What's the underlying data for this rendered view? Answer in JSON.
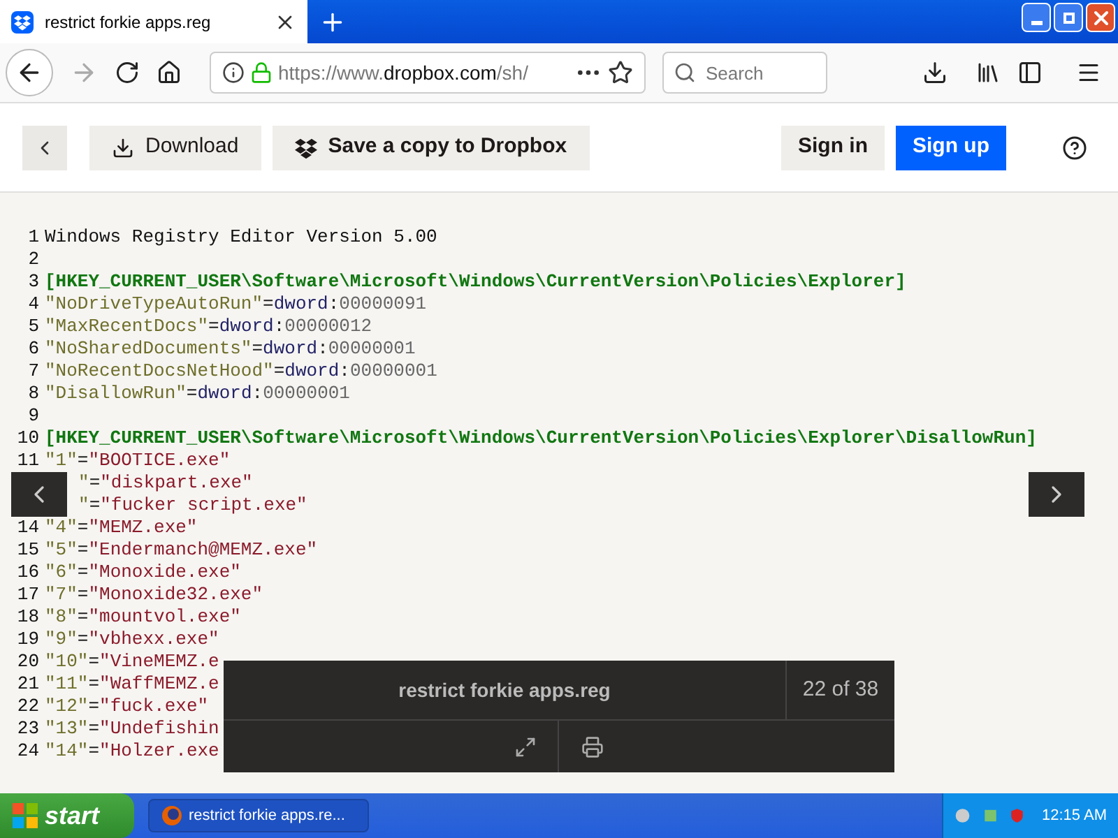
{
  "browser": {
    "tab_title": "restrict forkie apps.reg",
    "url_host_prefix": "https://www.",
    "url_host": "dropbox.com",
    "url_path": "/sh/",
    "search_placeholder": "Search"
  },
  "header": {
    "download": "Download",
    "save": "Save a copy to Dropbox",
    "sign_in": "Sign in",
    "sign_up": "Sign up"
  },
  "code": {
    "lines": [
      {
        "number": "1",
        "segments": [
          {
            "kind": "plain",
            "text": "Windows Registry Editor Version 5.00"
          }
        ]
      },
      {
        "number": "2"
      },
      {
        "number": "3",
        "segments": [
          {
            "kind": "key",
            "text": "[HKEY_CURRENT_USER\\Software\\Microsoft\\Windows\\CurrentVersion\\Policies\\Explorer]"
          }
        ]
      },
      {
        "number": "4",
        "segments": [
          {
            "kind": "name",
            "text": "\"NoDriveTypeAutoRun\""
          },
          {
            "kind": "eq",
            "text": "="
          },
          {
            "kind": "dword",
            "text": "dword"
          },
          {
            "kind": "eq",
            "text": ":"
          },
          {
            "kind": "hex",
            "text": "00000091"
          }
        ]
      },
      {
        "number": "5",
        "segments": [
          {
            "kind": "name",
            "text": "\"MaxRecentDocs\""
          },
          {
            "kind": "eq",
            "text": "="
          },
          {
            "kind": "dword",
            "text": "dword"
          },
          {
            "kind": "eq",
            "text": ":"
          },
          {
            "kind": "hex",
            "text": "00000012"
          }
        ]
      },
      {
        "number": "6",
        "segments": [
          {
            "kind": "name",
            "text": "\"NoSharedDocuments\""
          },
          {
            "kind": "eq",
            "text": "="
          },
          {
            "kind": "dword",
            "text": "dword"
          },
          {
            "kind": "eq",
            "text": ":"
          },
          {
            "kind": "hex",
            "text": "00000001"
          }
        ]
      },
      {
        "number": "7",
        "segments": [
          {
            "kind": "name",
            "text": "\"NoRecentDocsNetHood\""
          },
          {
            "kind": "eq",
            "text": "="
          },
          {
            "kind": "dword",
            "text": "dword"
          },
          {
            "kind": "eq",
            "text": ":"
          },
          {
            "kind": "hex",
            "text": "00000001"
          }
        ]
      },
      {
        "number": "8",
        "segments": [
          {
            "kind": "name",
            "text": "\"DisallowRun\""
          },
          {
            "kind": "eq",
            "text": "="
          },
          {
            "kind": "dword",
            "text": "dword"
          },
          {
            "kind": "eq",
            "text": ":"
          },
          {
            "kind": "hex",
            "text": "00000001"
          }
        ]
      },
      {
        "number": "9"
      },
      {
        "number": "10",
        "segments": [
          {
            "kind": "key",
            "text": "[HKEY_CURRENT_USER\\Software\\Microsoft\\Windows\\CurrentVersion\\Policies\\Explorer\\DisallowRun]"
          }
        ]
      },
      {
        "number": "11",
        "segments": [
          {
            "kind": "name",
            "text": "\"1\""
          },
          {
            "kind": "eq",
            "text": "="
          },
          {
            "kind": "string",
            "text": "\"BOOTICE.exe\""
          }
        ]
      },
      {
        "segments": [
          {
            "kind": "name",
            "text": "\""
          },
          {
            "kind": "eq",
            "text": "="
          },
          {
            "kind": "string",
            "text": "\"diskpart.exe\""
          }
        ]
      },
      {
        "segments": [
          {
            "kind": "name",
            "text": "\""
          },
          {
            "kind": "eq",
            "text": "="
          },
          {
            "kind": "string",
            "text": "\"fucker script.exe\""
          }
        ]
      },
      {
        "number": "14",
        "segments": [
          {
            "kind": "name",
            "text": "\"4\""
          },
          {
            "kind": "eq",
            "text": "="
          },
          {
            "kind": "string",
            "text": "\"MEMZ.exe\""
          }
        ]
      },
      {
        "number": "15",
        "segments": [
          {
            "kind": "name",
            "text": "\"5\""
          },
          {
            "kind": "eq",
            "text": "="
          },
          {
            "kind": "string",
            "text": "\"Endermanch@MEMZ.exe\""
          }
        ]
      },
      {
        "number": "16",
        "segments": [
          {
            "kind": "name",
            "text": "\"6\""
          },
          {
            "kind": "eq",
            "text": "="
          },
          {
            "kind": "string",
            "text": "\"Monoxide.exe\""
          }
        ]
      },
      {
        "number": "17",
        "segments": [
          {
            "kind": "name",
            "text": "\"7\""
          },
          {
            "kind": "eq",
            "text": "="
          },
          {
            "kind": "string",
            "text": "\"Monoxide32.exe\""
          }
        ]
      },
      {
        "number": "18",
        "segments": [
          {
            "kind": "name",
            "text": "\"8\""
          },
          {
            "kind": "eq",
            "text": "="
          },
          {
            "kind": "string",
            "text": "\"mountvol.exe\""
          }
        ]
      },
      {
        "number": "19",
        "segments": [
          {
            "kind": "name",
            "text": "\"9\""
          },
          {
            "kind": "eq",
            "text": "="
          },
          {
            "kind": "string",
            "text": "\"vbhexx.exe\""
          }
        ]
      },
      {
        "number": "20",
        "segments": [
          {
            "kind": "name",
            "text": "\"10\""
          },
          {
            "kind": "eq",
            "text": "="
          },
          {
            "kind": "string",
            "text": "\"VineMEMZ.e"
          }
        ]
      },
      {
        "number": "21",
        "segments": [
          {
            "kind": "name",
            "text": "\"11\""
          },
          {
            "kind": "eq",
            "text": "="
          },
          {
            "kind": "string",
            "text": "\"WaffMEMZ.e"
          }
        ]
      },
      {
        "number": "22",
        "segments": [
          {
            "kind": "name",
            "text": "\"12\""
          },
          {
            "kind": "eq",
            "text": "="
          },
          {
            "kind": "string",
            "text": "\"fuck.exe\""
          }
        ]
      },
      {
        "number": "23",
        "segments": [
          {
            "kind": "name",
            "text": "\"13\""
          },
          {
            "kind": "eq",
            "text": "="
          },
          {
            "kind": "string",
            "text": "\"Undefishin"
          }
        ]
      },
      {
        "number": "24",
        "segments": [
          {
            "kind": "name",
            "text": "\"14\""
          },
          {
            "kind": "eq",
            "text": "="
          },
          {
            "kind": "string",
            "text": "\"Holzer.exe"
          }
        ]
      }
    ]
  },
  "viewer": {
    "title": "restrict forkie apps.reg",
    "counter": "22 of 38"
  },
  "taskbar": {
    "start": "start",
    "task": "restrict forkie apps.re...",
    "clock": "12:15 AM"
  }
}
